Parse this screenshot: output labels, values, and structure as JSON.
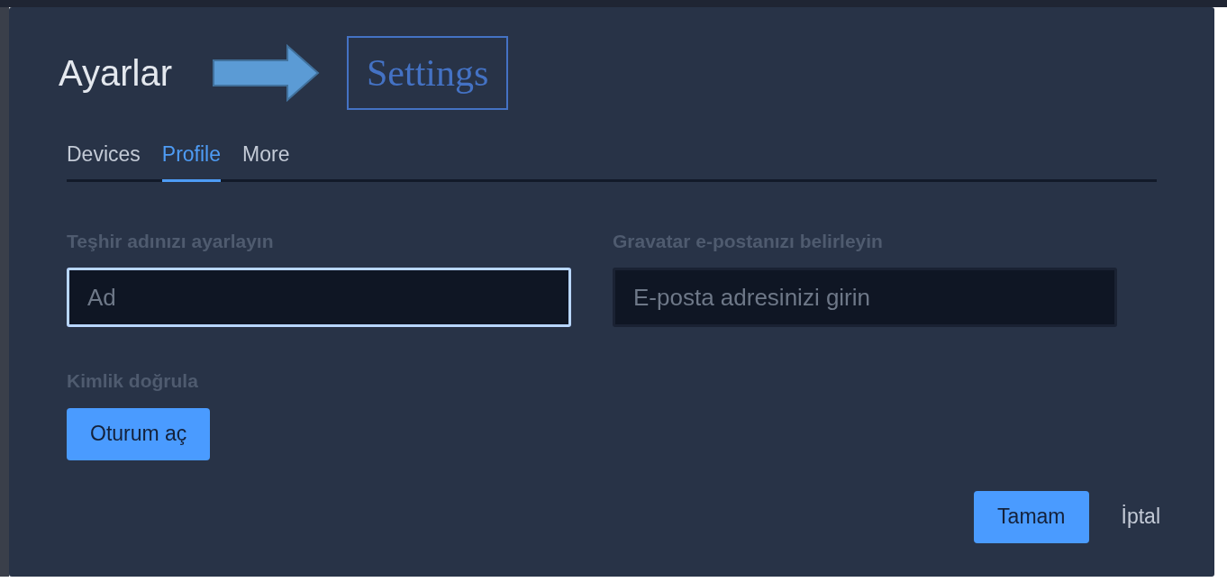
{
  "dialog": {
    "title": "Ayarlar"
  },
  "annotation": {
    "label": "Settings"
  },
  "tabs": [
    {
      "label": "Devices",
      "selected": false
    },
    {
      "label": "Profile",
      "selected": true
    },
    {
      "label": "More",
      "selected": false
    }
  ],
  "fields": [
    {
      "label": "Teşhir adınızı ayarlayın",
      "placeholder": "Ad",
      "focused": true
    },
    {
      "label": "Gravatar e-postanızı belirleyin",
      "placeholder": "E-posta adresinizi girin",
      "focused": false
    }
  ],
  "auth": {
    "label": "Kimlik doğrula",
    "button": "Oturum aç"
  },
  "buttons": [
    {
      "label": "Tamam",
      "kind": "primary"
    },
    {
      "label": "İptal",
      "kind": "link"
    }
  ]
}
